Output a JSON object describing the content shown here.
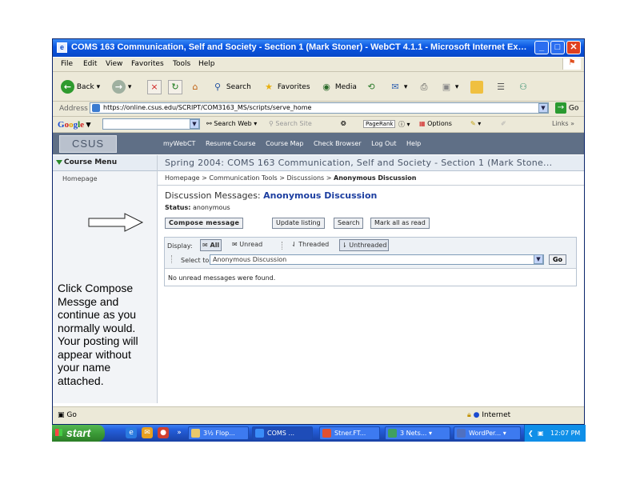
{
  "window": {
    "title": "COMS 163 Communication, Self and Society - Section 1 (Mark Stoner) - WebCT 4.1.1 - Microsoft Internet Expl...",
    "buttons": {
      "minimize": "_",
      "maximize": "□",
      "close": "✕"
    }
  },
  "menubar": [
    "File",
    "Edit",
    "View",
    "Favorites",
    "Tools",
    "Help"
  ],
  "toolbar": {
    "back": "Back",
    "search": "Search",
    "favorites": "Favorites",
    "media": "Media"
  },
  "address": {
    "label": "Address",
    "url": "https://online.csus.edu/SCRIPT/COM3163_MS/scripts/serve_home",
    "go": "Go"
  },
  "google": {
    "logo": "Google",
    "search_web": "Search Web",
    "search_site": "Search Site",
    "pagerank": "PageRank",
    "options": "Options",
    "links": "Links"
  },
  "banner": {
    "logo": "CSUS",
    "nav": [
      "myWebCT",
      "Resume Course",
      "Course Map",
      "Check Browser",
      "Log Out",
      "Help"
    ]
  },
  "course_title": "Spring 2004: COMS 163 Communication, Self and Society - Section 1 (Mark Stone...",
  "sidebar": {
    "menu_title": "Course Menu",
    "items": [
      "Homepage"
    ],
    "instruction": "Click Compose Messge and continue as you normally would. Your posting will appear without your name attached."
  },
  "breadcrumb": {
    "items": [
      "Homepage",
      "Communication Tools",
      "Discussions"
    ],
    "current": "Anonymous Discussion",
    "sep": ">"
  },
  "page": {
    "heading_prefix": "Discussion Messages:",
    "heading_topic": "Anonymous Discussion",
    "status_label": "Status:",
    "status_value": "anonymous",
    "buttons": {
      "compose": "Compose message",
      "update": "Update listing",
      "search": "Search",
      "mark_all": "Mark all as read"
    },
    "display_label": "Display:",
    "display_options": {
      "all": "All",
      "unread": "Unread",
      "threaded": "Threaded",
      "unthreaded": "Unthreaded"
    },
    "select_topic_label": "Select topic:",
    "select_topic_value": "Anonymous Discussion",
    "go": "Go",
    "no_messages": "No unread messages were found."
  },
  "statusbar": {
    "text": "Go",
    "zone": "Internet"
  },
  "taskbar": {
    "start": "start",
    "tasks": [
      "3½ Flop...",
      "COMS ...",
      "Stner.FT...",
      "3 Nets...",
      "WordPer..."
    ],
    "clock": "12:07 PM"
  }
}
